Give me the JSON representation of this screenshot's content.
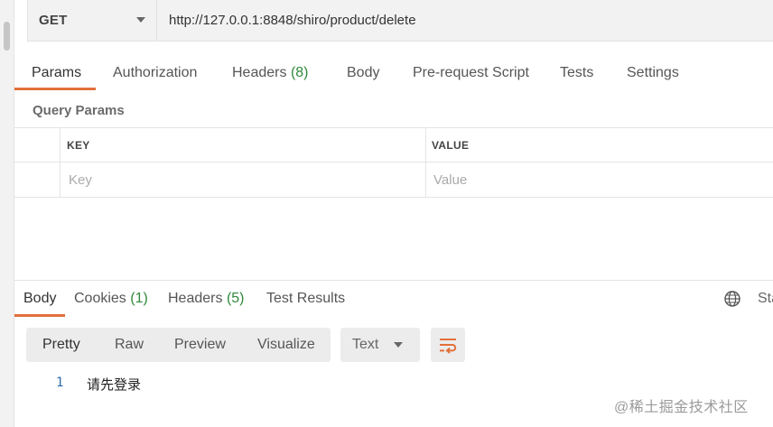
{
  "request": {
    "method": "GET",
    "url": "http://127.0.0.1:8848/shiro/product/delete"
  },
  "request_tabs": [
    {
      "label": "Params",
      "count": ""
    },
    {
      "label": "Authorization",
      "count": ""
    },
    {
      "label": "Headers",
      "count": "(8)"
    },
    {
      "label": "Body",
      "count": ""
    },
    {
      "label": "Pre-request Script",
      "count": ""
    },
    {
      "label": "Tests",
      "count": ""
    },
    {
      "label": "Settings",
      "count": ""
    }
  ],
  "query_params": {
    "title": "Query Params",
    "columns": [
      "KEY",
      "VALUE"
    ],
    "placeholders": {
      "key": "Key",
      "value": "Value"
    }
  },
  "response_tabs": [
    {
      "label": "Body",
      "count": ""
    },
    {
      "label": "Cookies",
      "count": "(1)"
    },
    {
      "label": "Headers",
      "count": "(5)"
    },
    {
      "label": "Test Results",
      "count": ""
    }
  ],
  "status_cut": "Sta",
  "view_modes": [
    "Pretty",
    "Raw",
    "Preview",
    "Visualize"
  ],
  "format": "Text",
  "response_body": [
    {
      "line": "1",
      "text": "请先登录"
    }
  ],
  "watermark": "@稀土掘金技术社区",
  "colors": {
    "accent": "#e2703a",
    "count": "#2f8a3b",
    "line_number": "#2a6aa8"
  },
  "icons": {
    "method_dropdown": "chevron-down-icon",
    "globe": "globe-icon",
    "wrap": "wrap-lines-icon",
    "format_dropdown": "chevron-down-icon"
  }
}
